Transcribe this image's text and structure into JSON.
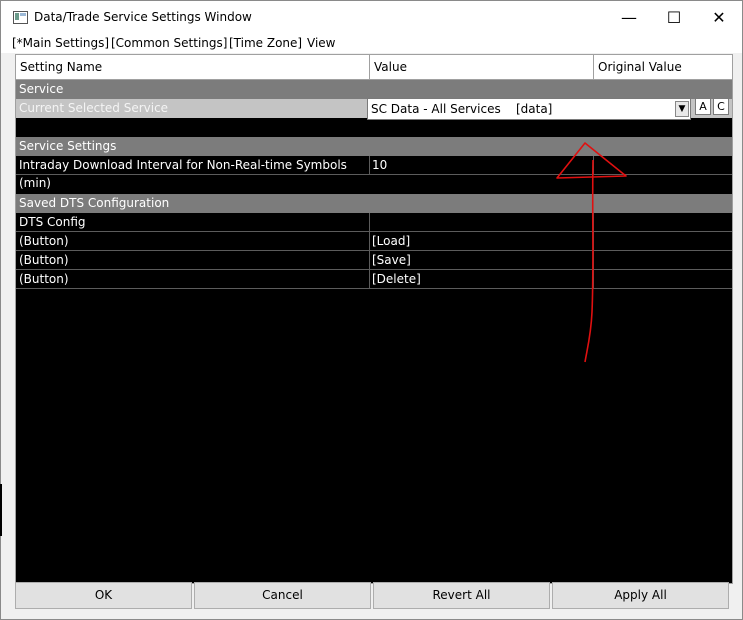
{
  "window": {
    "title": "Data/Trade Service Settings Window",
    "icon": "window-app-icon",
    "controls": {
      "minimize": "—",
      "maximize": "☐",
      "close": "✕"
    }
  },
  "menu": {
    "items": [
      "[*Main Settings]",
      "[Common Settings]",
      "[Time Zone]",
      "View"
    ]
  },
  "grid": {
    "columns": [
      "Setting Name",
      "Value",
      "Original Value"
    ],
    "sections": {
      "service": {
        "title": "Service",
        "current_service_label": "Current Selected Service",
        "current_service_value": "SC Data - All Services    [data]",
        "button_a": "A",
        "button_c": "C"
      },
      "service_settings": {
        "title": "Service Settings",
        "rows": [
          {
            "name": "Intraday Download Interval for Non-Real-time Symbols (min)",
            "value": "10",
            "original": ""
          }
        ]
      },
      "saved_dts": {
        "title": "Saved DTS Configuration",
        "rows": [
          {
            "name": "DTS Config",
            "value": "",
            "original": ""
          },
          {
            "name": "(Button)",
            "value": "[Load]",
            "original": ""
          },
          {
            "name": "(Button)",
            "value": "[Save]",
            "original": ""
          },
          {
            "name": "(Button)",
            "value": "[Delete]",
            "original": ""
          }
        ]
      }
    }
  },
  "footer": {
    "ok": "OK",
    "cancel": "Cancel",
    "revert": "Revert All",
    "apply": "Apply All"
  },
  "colors": {
    "annotation": "#e01010",
    "section_bg": "#7c7c7c",
    "grid_bg": "#000000"
  }
}
